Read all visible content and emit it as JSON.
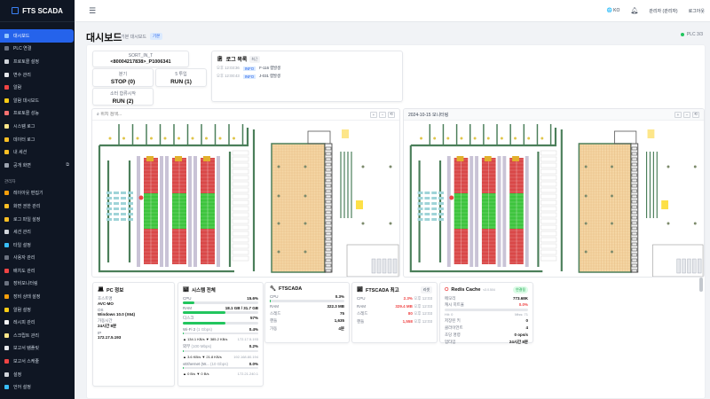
{
  "app": {
    "name": "FTS SCADA"
  },
  "sidebar": {
    "items": [
      {
        "label": "대시보드",
        "icon": "dashboard-icon",
        "color": "#93c5fd",
        "active": true
      },
      {
        "label": "PLC 연결",
        "icon": "plug-icon",
        "color": "#6b7280"
      },
      {
        "label": "프로토콜 설정",
        "icon": "gear-icon",
        "color": "#d1d5db"
      },
      {
        "label": "변수 관리",
        "icon": "clipboard-icon",
        "color": "#e5e7eb"
      },
      {
        "label": "알람",
        "icon": "alarm-icon",
        "color": "#ef4444"
      },
      {
        "label": "알람 대시보드",
        "icon": "bell-icon",
        "color": "#facc15"
      },
      {
        "label": "프로토콜 성능",
        "icon": "chart-icon",
        "color": "#f87171"
      },
      {
        "label": "시스템 로그",
        "icon": "scroll-icon",
        "color": "#fde68a"
      },
      {
        "label": "데이터 로그",
        "icon": "folder-icon",
        "color": "#fbbf24"
      },
      {
        "label": "내 세션",
        "icon": "lock-icon",
        "color": "#fbbf24"
      },
      {
        "label": "공개 화면",
        "icon": "monitor-icon",
        "color": "#9ca3af",
        "external": "⧉"
      }
    ],
    "admin_label": "관리자",
    "admin_items": [
      {
        "label": "레이아웃 편집기",
        "icon": "palette-icon",
        "color": "#f59e0b"
      },
      {
        "label": "화면 권한 관리",
        "icon": "folder-lock-icon",
        "color": "#fbbf24"
      },
      {
        "label": "로그 파일 설정",
        "icon": "folder-icon",
        "color": "#fbbf24"
      },
      {
        "label": "세션 관리",
        "icon": "eye-icon",
        "color": "#d1d5db"
      },
      {
        "label": "타일 설정",
        "icon": "globe-icon",
        "color": "#38bdf8"
      },
      {
        "label": "사용자 관리",
        "icon": "users-icon",
        "color": "#6b7280"
      },
      {
        "label": "배치도 관리",
        "icon": "pin-icon",
        "color": "#ef4444"
      },
      {
        "label": "장비모니터링",
        "icon": "monitor-icon",
        "color": "#6b7280"
      },
      {
        "label": "장비 상태 설정",
        "icon": "crane-icon",
        "color": "#f59e0b"
      },
      {
        "label": "알람 설정",
        "icon": "bell-icon",
        "color": "#facc15"
      },
      {
        "label": "레시피 관리",
        "icon": "mail-icon",
        "color": "#f3f4f6"
      },
      {
        "label": "스크립트 관리",
        "icon": "scroll-icon",
        "color": "#fde68a"
      },
      {
        "label": "보고서 템플릿",
        "icon": "clipboard-icon",
        "color": "#e5e7eb"
      },
      {
        "label": "보고서 스케줄",
        "icon": "alarm-clock-icon",
        "color": "#ef4444"
      },
      {
        "label": "설정",
        "icon": "gear-icon",
        "color": "#d1d5db"
      },
      {
        "label": "언어 설정",
        "icon": "globe-icon",
        "color": "#38bdf8"
      }
    ]
  },
  "topbar": {
    "lang": "KO",
    "user": "관리자 (관리자)",
    "logout": "로그아웃"
  },
  "page": {
    "title": "대시보드",
    "subtitle": "기본 대시보드",
    "badge": "기본",
    "plc_status": "PLC 3/3"
  },
  "widgets": [
    {
      "label": "SORT_IN_T",
      "value": "<80004217838>_P1006341"
    },
    {
      "label": "분기",
      "value": "STOP (0)"
    },
    {
      "label": "5 투입",
      "value": "RUN (1)"
    },
    {
      "label": "소터 합류시작",
      "value": "RUN (2)"
    }
  ],
  "log": {
    "title": "로그 목록",
    "count": "최근",
    "rows": [
      {
        "time": "오후 12:03:36",
        "level": "INFO",
        "msg": "F-116 랩발생"
      },
      {
        "time": "오후 12:00:43",
        "level": "INFO",
        "msg": "J-031 랩발생"
      }
    ]
  },
  "maps": {
    "left": {
      "search_placeholder": "위치 검색..."
    },
    "right": {
      "title": "2024-10-15 모니터링"
    },
    "zoom_in": "+",
    "zoom_out": "−",
    "reset": "⟲"
  },
  "pc_info": {
    "title": "PC 정보",
    "fields": [
      {
        "label": "호스트명",
        "value": "AVC-MO"
      },
      {
        "label": "OS",
        "value": "Windows 10.0 (X64)"
      },
      {
        "label": "가동시간",
        "value": "24시간 8분"
      },
      {
        "label": "IP",
        "value": "172.17.5.193"
      }
    ]
  },
  "system": {
    "title": "시스템 전체",
    "cpu": {
      "label": "CPU",
      "value": "15.6%",
      "pct": 15.6
    },
    "ram": {
      "label": "RAM",
      "value": "18.1 GB / 31.7 GB",
      "pct": 57
    },
    "disk": {
      "label": "디스크",
      "value": "57%",
      "pct": 57
    },
    "nets": [
      {
        "name": "Wi-Fi 2",
        "speed": "(1 Gbps)",
        "pct_label": "0.4%",
        "pct": 0.4,
        "up": "▲ 134.1 KB/s",
        "down": "▼ 385.2 KB/s",
        "ip": "172.17.5.193"
      },
      {
        "name": "외부",
        "speed": "(100 Mbps)",
        "pct_label": "0.2%",
        "pct": 0.2,
        "up": "▲ 3.6 KB/s",
        "down": "▼ 21.8 KB/s",
        "ip": "192.168.80.194"
      },
      {
        "name": "vEthernet (W...",
        "speed": "(10 Gbps)",
        "pct_label": "0.0%",
        "pct": 0,
        "up": "▲ 0 B/s",
        "down": "▼ 0 B/s",
        "ip": "172.21.240.1"
      }
    ]
  },
  "ftscada": {
    "title": "FTSCADA",
    "cpu": {
      "label": "CPU",
      "value": "0.3%",
      "pct": 0.3
    },
    "rows": [
      {
        "label": "RAM",
        "value": "322.3 MB"
      },
      {
        "label": "스레드",
        "value": "75"
      },
      {
        "label": "핸들",
        "value": "1,635"
      },
      {
        "label": "가동",
        "value": "4분"
      }
    ]
  },
  "ftscada_peak": {
    "title": "FTSCADA 최고",
    "reset": "리셋",
    "rows": [
      {
        "label": "CPU",
        "value": "2.3%",
        "time": "오후 12:03"
      },
      {
        "label": "RAM",
        "value": "329.4 MB",
        "time": "오후 12:03"
      },
      {
        "label": "스레드",
        "value": "80",
        "time": "오후 12:03"
      },
      {
        "label": "핸들",
        "value": "1,558",
        "time": "오후 12:03"
      }
    ]
  },
  "redis": {
    "title": "Redis Cache",
    "version": "v3.0.504",
    "status": "연결됨",
    "rows": [
      {
        "label": "메모리",
        "value": "773.68K"
      },
      {
        "label": "캐시 히트율",
        "value": "0.0%",
        "red": true
      }
    ],
    "hits": "Hit: 0",
    "misses": "Miss: 71",
    "rows2": [
      {
        "label": "저장된 키",
        "value": "0"
      },
      {
        "label": "클라이언트",
        "value": "4"
      },
      {
        "label": "초당 명령",
        "value": "0 ops/s"
      },
      {
        "label": "업타임",
        "value": "24시간 8분"
      }
    ]
  },
  "colors": {
    "accent": "#2563eb",
    "sidebar": "#0f1623",
    "ok": "#22c55e",
    "rack_red": "#d94848",
    "rack_green": "#3ec43e",
    "floor": "#f5d7a6"
  }
}
